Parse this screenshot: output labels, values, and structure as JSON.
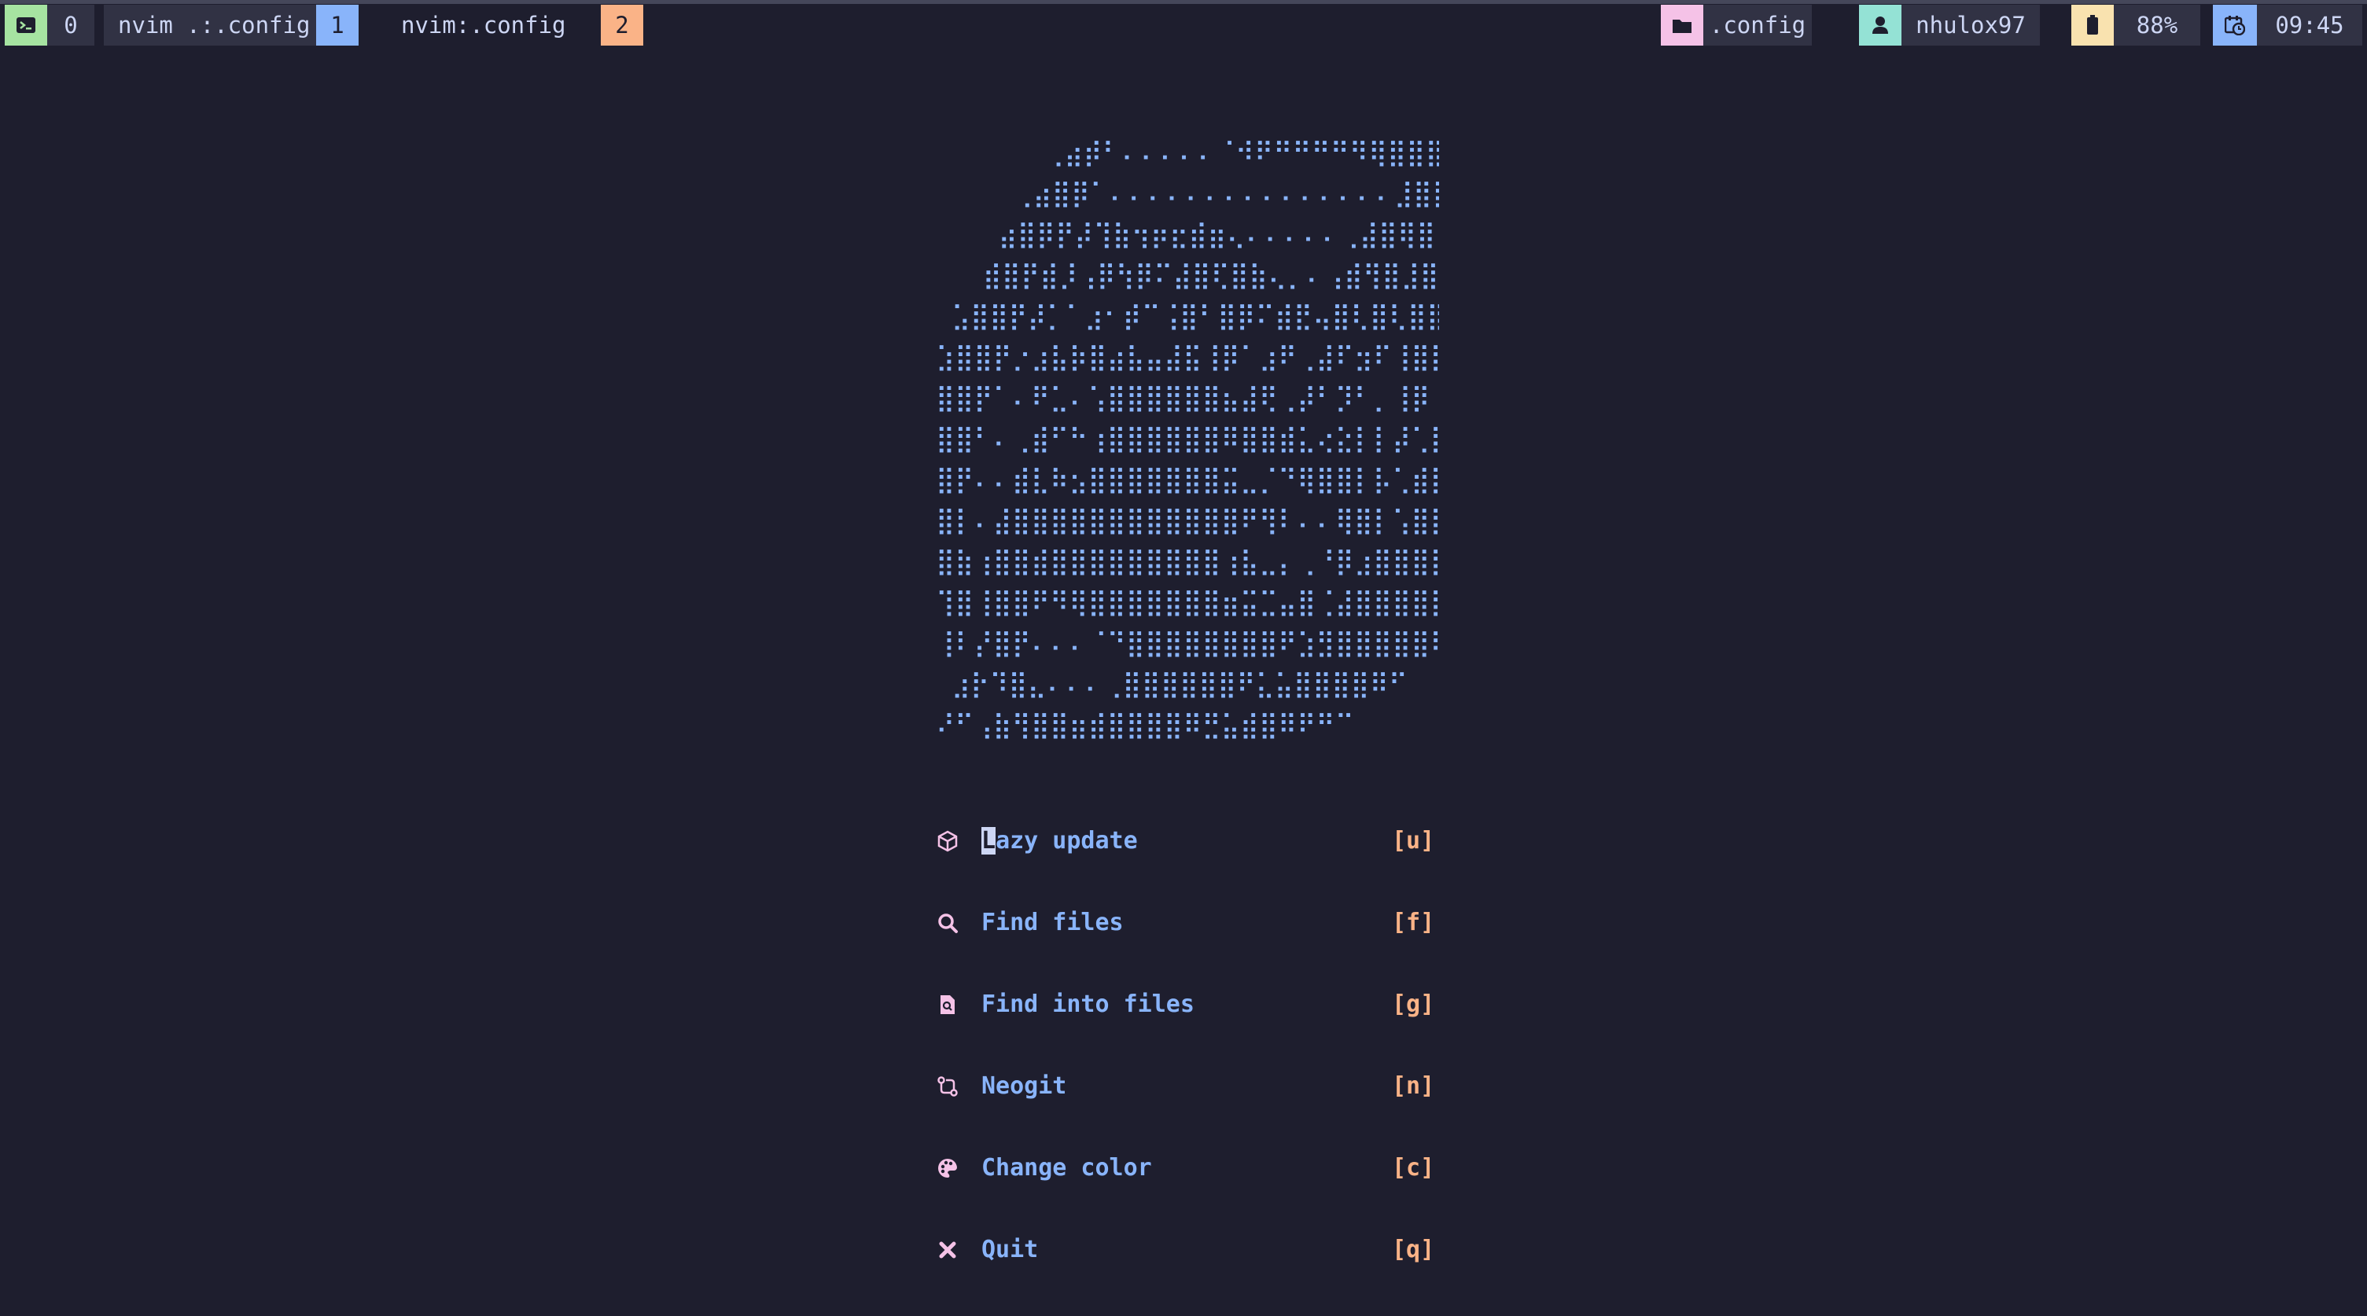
{
  "status_bar": {
    "left": {
      "session_index": "0",
      "windows": [
        {
          "title": "nvim .:.config",
          "index": "1",
          "color": "#89b4fa"
        },
        {
          "title": "nvim:.config",
          "index": "2",
          "color": "#fab387"
        }
      ]
    },
    "right": {
      "directory": ".config",
      "user": "nhulox97",
      "battery": "88%",
      "time": "09:45"
    },
    "colors": {
      "session": "#a6e3a1",
      "directory": "#f5c2e7",
      "user": "#94e2d5",
      "battery": "#f9e2af",
      "time": "#89b4fa"
    }
  },
  "dashboard": {
    "logo_lines": [
      "       ⢀⣴⡾⠃⠄⠄⠄⠄⠄⠈⠺⠟⠛⠛⠛⠛⠻⢿⣿⣿⣿⣿⣶⣤⡀  ",
      "     ⢀⣴⣿⡿⠁⠄⠄⠄⠄⠄⠄⠄⠄⠄⠄⠄⠄⠄⠄⠄⣸⣿⣿⣿⣿⣿⣿⣿⣷ ",
      "    ⣴⣿⡿⡟⡼⢹⣷⢲⡶⣖⣾⣶⢄⠄⠄⠄⠄⠄⢀⣼⣿⢿⣿⣿⣿⣿⣿⣿⣿ ",
      "   ⣾⣿⡟⣾⡸⢠⡿⢳⡿⠍⣼⣿⢏⣿⣷⢄⡀⠄⢠⣾⢻⣿⣸⣿⣿⣿⣿⣿⣿⣿ ",
      " ⣡⣿⣿⡟⡼⡁⠁⣰⠂⡾⠉⢨⣿⠃⣿⡿⠍⣾⣟⢤⣿⢇⣿⢇⣿⣿⢿⣿⣿⣿⣿⣿ ",
      "⣱⣿⣿⡟⡐⣰⣧⡷⣿⣴⣧⣤⣼⣯⢸⡿⠁⣰⠟⢀⣼⠏⣲⠏⢸⣿⡟⣿⣿⣿⣿⣿⣿ ",
      "⣿⣿⡟⠁⠄⠟⣁⠄⢡⣿⣿⣿⣿⣿⣿⣦⣼⢟⢀⡼⠃⡹⠃⡀⢸⡿⢸⣿⣿⣿⣿⣿⡟ ",
      "⣿⣿⠃⠄⢀⣾⠋⠓⢰⣿⣿⣿⣿⣿⣿⠿⣿⣿⣾⣅⢔⣕⡇⡇⡼⢁⣿⣿⣿⣿⣿⣿⢣ ",
      "⣿⡟⠄⠄⣾⣇⠷⣢⣿⣿⣿⣿⣿⣿⣿⣭⣀⡈⠙⢿⣿⣿⡇⡧⢁⣾⣿⣿⣿⣿⣿⣿⣿ ",
      "⣿⡇⠄⣼⣿⣿⣿⣿⣿⣿⣿⣿⣿⣿⣿⣿⠟⢻⠇⠄⠄⢿⣿⡇⢡⣿⣿⣿⣿⣿⣿⣿⣿ ",
      "⣿⣷⢰⣿⣿⣾⣿⣿⣿⣿⣿⣿⣿⣿⣿⢰⣧⣀⡄⢀⠘⡿⣰⣿⣿⣿⣿⣿⣿⠟⣼⣿⣿ ",
      "⢹⣿⢸⣿⣿⠟⠻⢿⣿⣿⣿⣿⣿⣿⣿⣶⣭⣉⣤⣿⢈⣼⣿⣿⣿⣿⣿⣿⠏⣾⣹⣿⣿ ",
      "⢸⠇⡜⣿⡟⠄⠄⠄⠈⠙⣿⣿⣿⣿⣿⣿⣿⣿⠟⣱⣻⣿⣿⣿⣿⣿⠟⠁⢳⠃⣿⣿⣿ ",
      " ⣰⡗⠹⣿⣄⠄⠄⠄⢀⣿⣿⣿⣿⣿⣿⠟⣅⣥⣿⣿⣿⣿⠿⠋  ⣾⡌⢠⣿⡿⠃ ",
      "⠜⠋⢠⣷⢻⣿⣿⣶⣾⣿⣿⣿⣿⠿⣛⣥⣾⣿⠿⠟⠛⠉           "
    ],
    "menu": [
      {
        "icon": "package-icon",
        "glyph": "⬡",
        "cursor_char": "L",
        "label": "azy update",
        "key": "[u]"
      },
      {
        "icon": "search-icon",
        "glyph": "⚲",
        "cursor_char": "",
        "label": "Find files",
        "key": "[f]"
      },
      {
        "icon": "file-search-icon",
        "glyph": "▣",
        "cursor_char": "",
        "label": "Find into files",
        "key": "[g]"
      },
      {
        "icon": "git-compare-icon",
        "glyph": "⇄",
        "cursor_char": "",
        "label": "Neogit",
        "key": "[n]"
      },
      {
        "icon": "palette-icon",
        "glyph": "◕",
        "cursor_char": "",
        "label": "Change color",
        "key": "[c]"
      },
      {
        "icon": "close-icon",
        "glyph": "✖",
        "cursor_char": "",
        "label": "Quit",
        "key": "[q]"
      }
    ]
  }
}
